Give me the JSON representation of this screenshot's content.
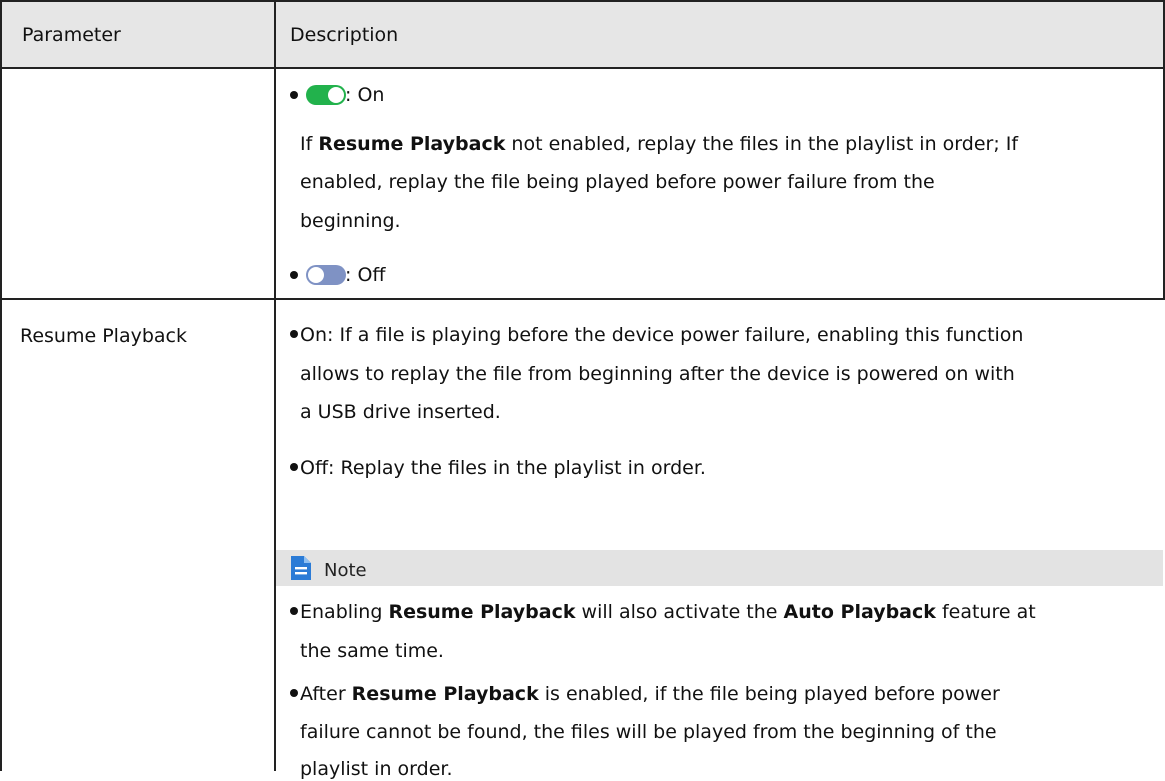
{
  "header": {
    "parameter": "Parameter",
    "description": "Description"
  },
  "row1": {
    "on_label": ": On",
    "on_text_line1_pre": "If ",
    "on_text_line1_bold": "Resume Playback",
    "on_text_line1_post": " not enabled, replay the files in the playlist in order; If",
    "on_text_line2": "enabled, replay the file being played before power failure from the",
    "on_text_line3": "beginning.",
    "off_label": ": Off",
    "toggle_on_color": "#22b24c",
    "toggle_off_color": "#7f92c4"
  },
  "row2": {
    "parameter": "Resume Playback",
    "bullet1_line1": "On: If a file is playing before the device power failure, enabling this function",
    "bullet1_line2": "allows to replay the file from beginning after the device is powered on with",
    "bullet1_line3": "a USB drive inserted.",
    "bullet2": "Off: Replay the files in the playlist in order.",
    "note_label": "Note",
    "note_icon": "note-document-icon",
    "note_b1_pre": "Enabling ",
    "note_b1_bold1": "Resume Playback",
    "note_b1_mid": " will also activate the ",
    "note_b1_bold2": "Auto Playback",
    "note_b1_post": " feature at",
    "note_b1_line2": "the same time.",
    "note_b2_pre": "After ",
    "note_b2_bold": "Resume Playback",
    "note_b2_post": " is enabled, if the file being played before power",
    "note_b2_line2": "failure cannot be found, the files will be played from the beginning of the",
    "note_b2_line3": "playlist in order."
  }
}
